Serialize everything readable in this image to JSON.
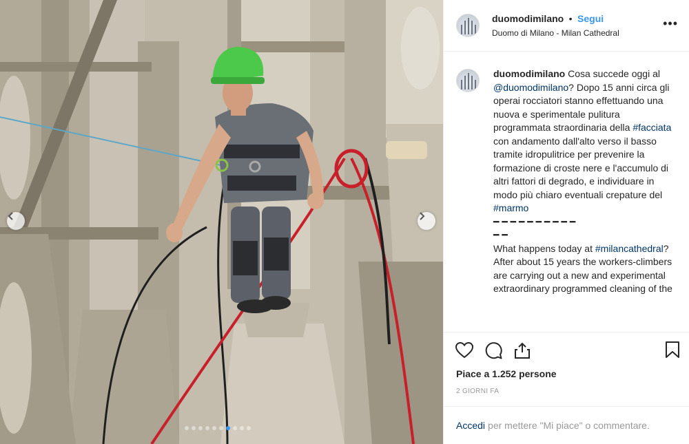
{
  "post": {
    "username": "duomodimilano",
    "separator": "•",
    "follow_label": "Segui",
    "location": "Duomo di Milano - Milan Cathedral",
    "more_label": "•••"
  },
  "caption": {
    "username": "duomodimilano",
    "text_1": " Cosa succede oggi al ",
    "mention": "@duomodimilano",
    "text_2": "? Dopo 15 anni circa gli operai rocciatori stanno effettuando una nuova e sperimentale pulitura programmata straordinaria della ",
    "tag_facciata": "#facciata",
    "text_3": " con andamento dall'alto verso il basso tramite idropulitrice per prevenire la formazione di croste nere e l'accumulo di altri fattori di degrado, e individuare in modo più chiaro eventuali crepature del ",
    "tag_marmo": "#marmo",
    "dashes_1": "━ ━ ━ ━ ━ ━ ━ ━ ━ ━",
    "dashes_2": "━ ━",
    "text_4": "What happens today at ",
    "tag_milancathedral": "#milancathedral",
    "text_5": "? After about 15 years the workers-climbers are carrying out a new and experimental extraordinary programmed cleaning of the"
  },
  "likes": "Piace a 1.252 persone",
  "timestamp": "2 GIORNI FA",
  "login": {
    "link": "Accedi",
    "text": "per mettere \"Mi piace\" o commentare."
  },
  "carousel": {
    "total": 10,
    "active_index": 6
  },
  "colors": {
    "link_blue": "#3897f0",
    "tag_blue": "#003569",
    "helmet_green": "#4cc94a",
    "rope_red": "#c8202a"
  },
  "icons": [
    "heart-icon",
    "comment-icon",
    "share-icon",
    "bookmark-icon",
    "chevron-left-icon",
    "chevron-right-icon"
  ]
}
